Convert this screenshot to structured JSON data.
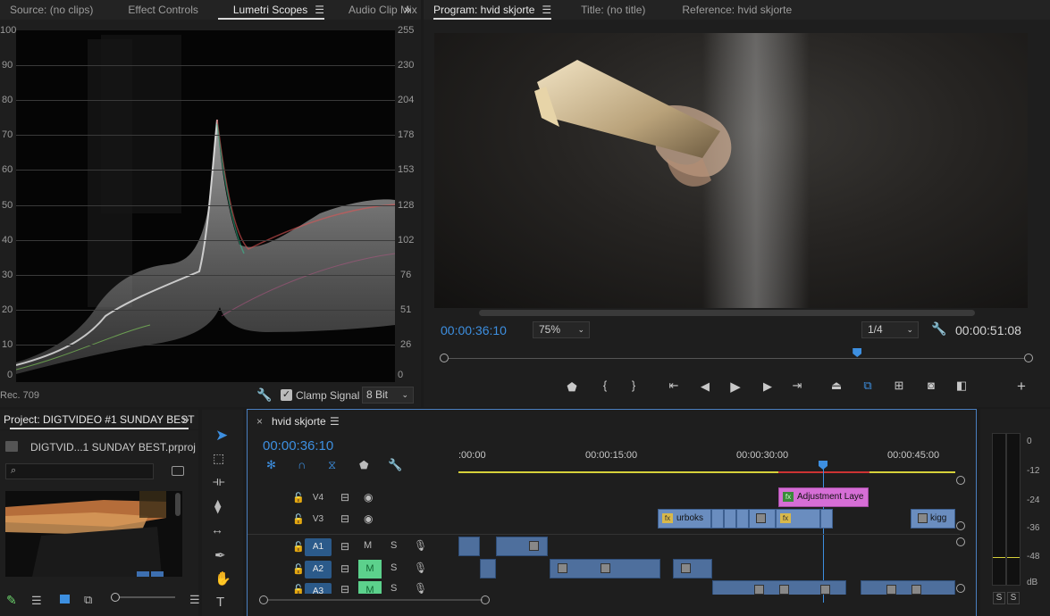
{
  "left_tabs": {
    "items": [
      {
        "label": "Source: (no clips)",
        "active": false
      },
      {
        "label": "Effect Controls",
        "active": false
      },
      {
        "label": "Lumetri Scopes",
        "active": true
      },
      {
        "label": "Audio Clip Mix",
        "active": false
      }
    ],
    "menu_icon": "hamburger-icon",
    "overflow_icon": "chevron-double-right-icon"
  },
  "scopes": {
    "left_scale": [
      "100",
      "90",
      "80",
      "70",
      "60",
      "50",
      "40",
      "30",
      "20",
      "10",
      "0"
    ],
    "right_scale": [
      "255",
      "230",
      "204",
      "178",
      "153",
      "128",
      "102",
      "76",
      "51",
      "26",
      "0"
    ],
    "colorspace": "Rec. 709",
    "clamp_label": "Clamp Signal",
    "clamp_checked": true,
    "bit_depth": "8 Bit"
  },
  "program_tabs": {
    "items": [
      {
        "label": "Program: hvid skjorte",
        "active": true
      },
      {
        "label": "Title: (no title)",
        "active": false
      },
      {
        "label": "Reference: hvid skjorte",
        "active": false
      }
    ]
  },
  "program": {
    "timecode": "00:00:36:10",
    "zoom": "75%",
    "resolution": "1/4",
    "duration": "00:00:51:08",
    "playhead_fraction": 0.71,
    "colors": {
      "timecode": "#3d8fe0"
    }
  },
  "transport": {
    "buttons": [
      "marker-icon",
      "mark-in-icon",
      "mark-out-icon",
      "go-to-in-icon",
      "step-back-icon",
      "play-icon",
      "step-forward-icon",
      "go-to-out-icon",
      "lift-icon",
      "extract-icon",
      "insert-icon",
      "camera-icon",
      "compare-icon"
    ],
    "add_icon": "plus-icon"
  },
  "project": {
    "tab_label": "Project: DIGTVIDEO #1 SUNDAY BEST",
    "file_name": "DIGTVID...1 SUNDAY BEST.prproj",
    "search_placeholder": ""
  },
  "timeline": {
    "sequence_name": "hvid skjorte",
    "timecode": "00:00:36:10",
    "ruler": [
      ":00:00",
      "00:00:15:00",
      "00:00:30:00",
      "00:00:45:00"
    ],
    "tracks": [
      {
        "name": "V4",
        "kind": "video"
      },
      {
        "name": "V3",
        "kind": "video"
      },
      {
        "name": "A1",
        "kind": "audio"
      },
      {
        "name": "A2",
        "kind": "audio"
      },
      {
        "name": "A3",
        "kind": "audio"
      }
    ],
    "track_buttons": {
      "mute": "M",
      "solo": "S"
    },
    "clips": {
      "adjustment": "Adjustment Laye",
      "urboks": "urboks",
      "kigg": "kigg",
      "fx": "fx"
    }
  },
  "meters": {
    "scale": [
      "0",
      "-12",
      "-24",
      "-36",
      "-48",
      "dB"
    ],
    "solo_left": "S",
    "solo_right": "S"
  }
}
